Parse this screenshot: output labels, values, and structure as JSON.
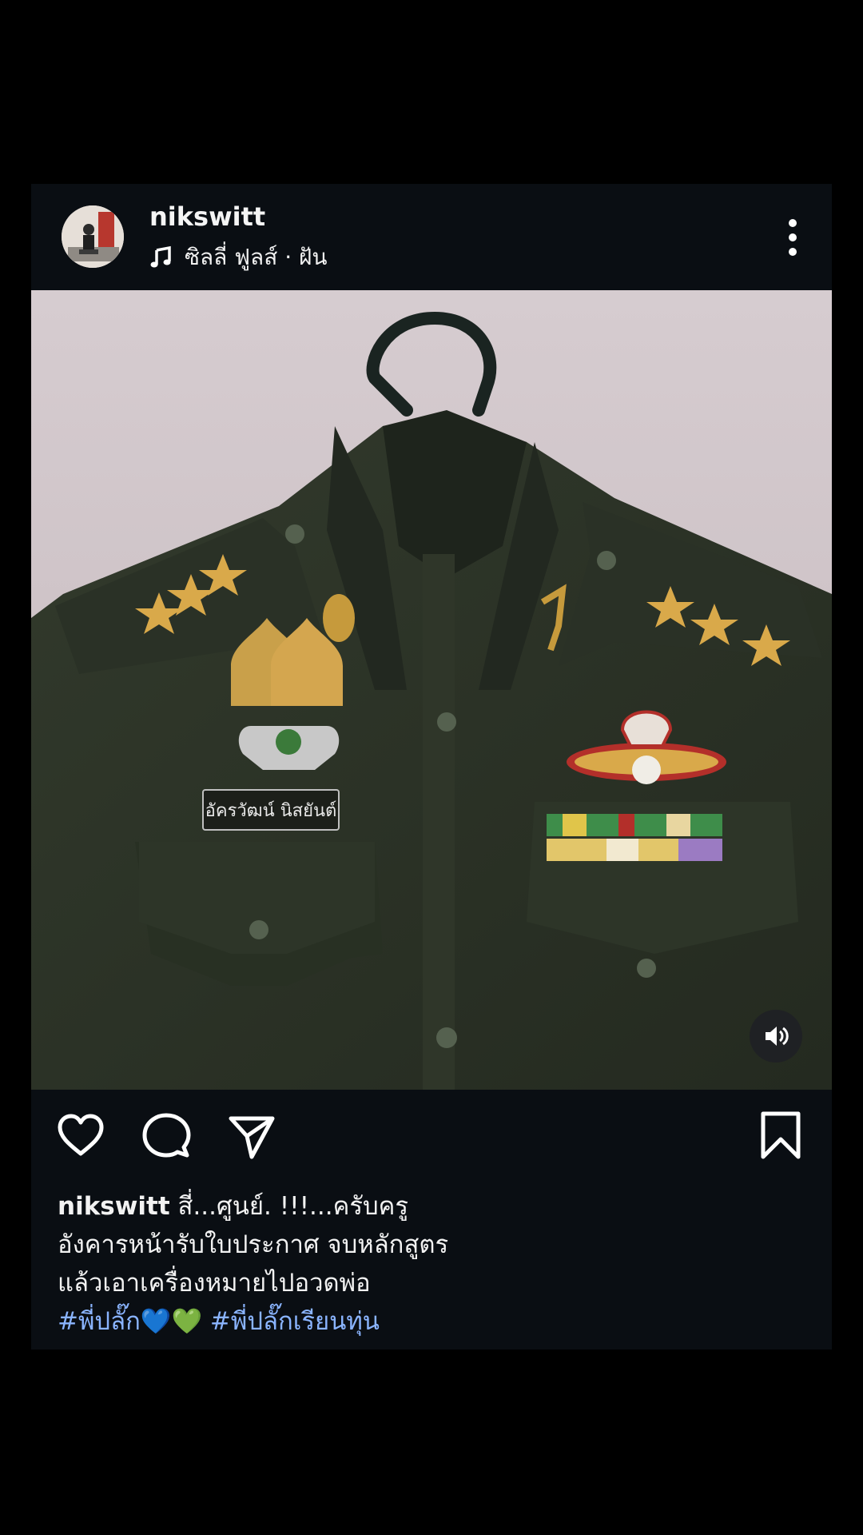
{
  "post": {
    "username": "nikswitt",
    "music": "ซิลลี่ ฟูลส์ · ฝัน",
    "more_icon": "more-vertical-icon",
    "name_tag": "อัครวัฒน์ นิสยันต์"
  },
  "actions": {
    "like_icon": "heart-icon",
    "comment_icon": "comment-icon",
    "share_icon": "send-icon",
    "save_icon": "bookmark-icon",
    "mute_icon": "volume-icon"
  },
  "caption": {
    "username": "nikswitt",
    "line1": "สี่...ศูนย์. !!!...ครับครู",
    "line2": "อังคารหน้ารับใบประกาศ จบหลักสูตร",
    "line3": "แล้วเอาเครื่องหมายไปอวดพ่อ",
    "tag1": "#พี่ปลั๊ก💙💚",
    "tag2": "#พี่ปลั๊กเรียนทุ่น"
  },
  "colors": {
    "background": "#000000",
    "card": "#0a0e13",
    "hashtag": "#8ab4ff",
    "shirt": "#2c3327",
    "wall": "#cfc4c8"
  }
}
